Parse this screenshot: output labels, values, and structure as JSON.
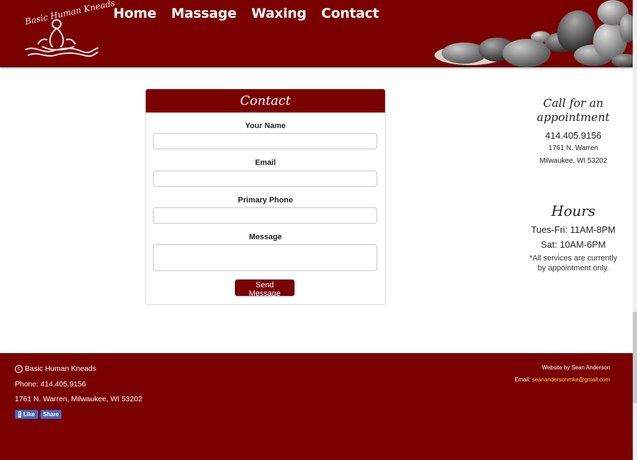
{
  "header": {
    "logo_text": "Basic Human Kneads",
    "nav": [
      "Home",
      "Massage",
      "Waxing",
      "Contact"
    ]
  },
  "form": {
    "title": "Contact",
    "fields": [
      {
        "label": "Your Name",
        "value": ""
      },
      {
        "label": "Email",
        "value": ""
      },
      {
        "label": "Primary Phone",
        "value": ""
      },
      {
        "label": "Message",
        "value": ""
      }
    ],
    "submit_label": "Send Message"
  },
  "sidebar": {
    "call_heading_1": "Call for an",
    "call_heading_2": "appointment",
    "phone": "414.405.9156",
    "address_1": "1761 N. Warren",
    "address_2": "Milwaukee, WI 53202",
    "hours_heading": "Hours",
    "hours_1": "Tues-Fri: 11AM-8PM",
    "hours_2": "Sat: 10AM-6PM",
    "note_1": "*All services are currently",
    "note_2": "by appointment only."
  },
  "footer": {
    "copyright_symbol": "c",
    "business_name": "Basic Human Kneads",
    "phone_line": "Phone: 414.405.9156",
    "address_line": "1761 N. Warren, Milwaukee, WI 53202",
    "like_label": "Like",
    "share_label": "Share",
    "credit": "Website by Sean Anderson",
    "email_label": "Email:",
    "email": "seanandersonmke@gmail.com"
  },
  "colors": {
    "brand": "#7b0000",
    "accent_link": "#ffd84a",
    "facebook": "#4c69ba"
  }
}
